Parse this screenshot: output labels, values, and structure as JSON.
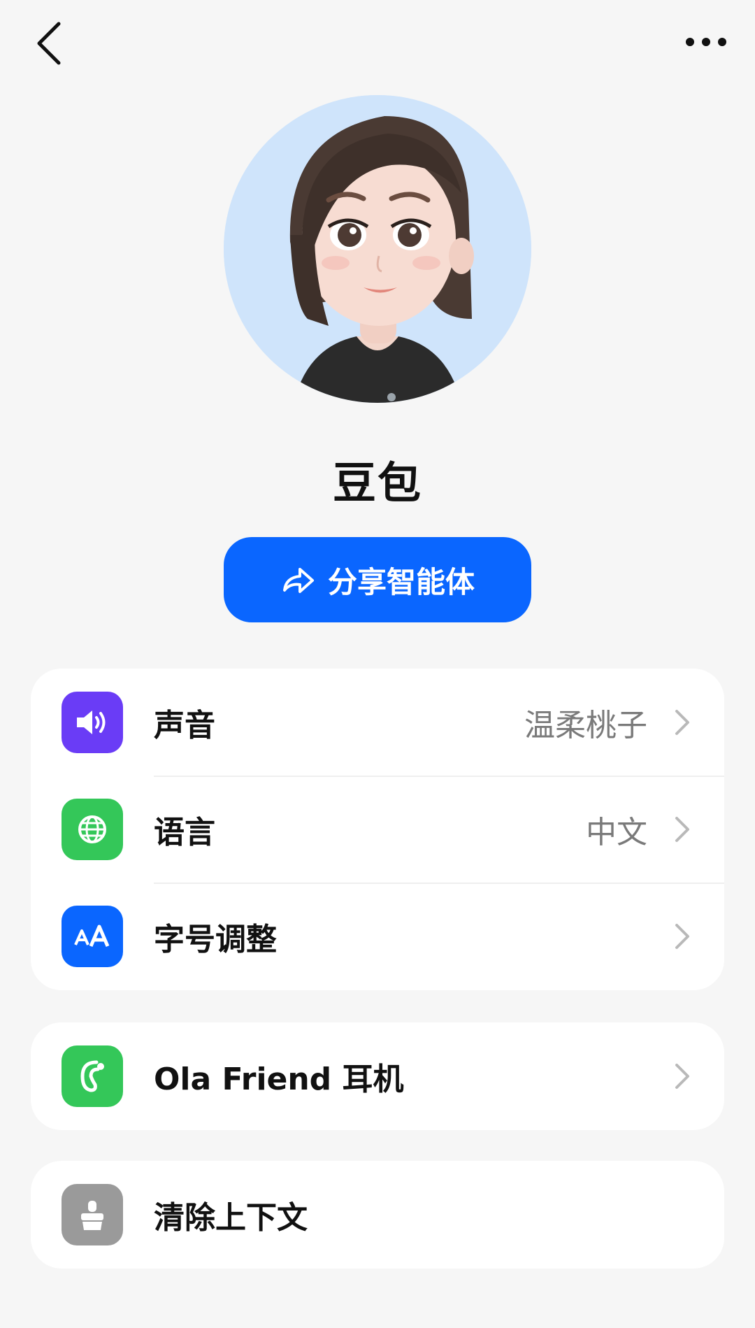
{
  "header": {
    "back_icon": "chevron-left-icon",
    "more_icon": "more-horizontal-icon"
  },
  "profile": {
    "name": "豆包",
    "avatar_bg": "#cfe4fb"
  },
  "share_button": {
    "label": "分享智能体",
    "icon": "share-arrow-icon",
    "color": "#0a66ff"
  },
  "settings": {
    "group1": [
      {
        "label": "声音",
        "value": "温柔桃子",
        "icon": "speaker-icon",
        "icon_color": "#6a3cf6"
      },
      {
        "label": "语言",
        "value": "中文",
        "icon": "globe-icon",
        "icon_color": "#34c759"
      },
      {
        "label": "字号调整",
        "value": "",
        "icon": "font-size-icon",
        "icon_color": "#0a66ff"
      }
    ],
    "group2": [
      {
        "label": "Ola Friend 耳机",
        "icon": "earphone-icon",
        "icon_color": "#34c759"
      }
    ],
    "group3": [
      {
        "label": "清除上下文",
        "icon": "clear-context-icon",
        "icon_color": "#9a9a9a"
      }
    ]
  }
}
